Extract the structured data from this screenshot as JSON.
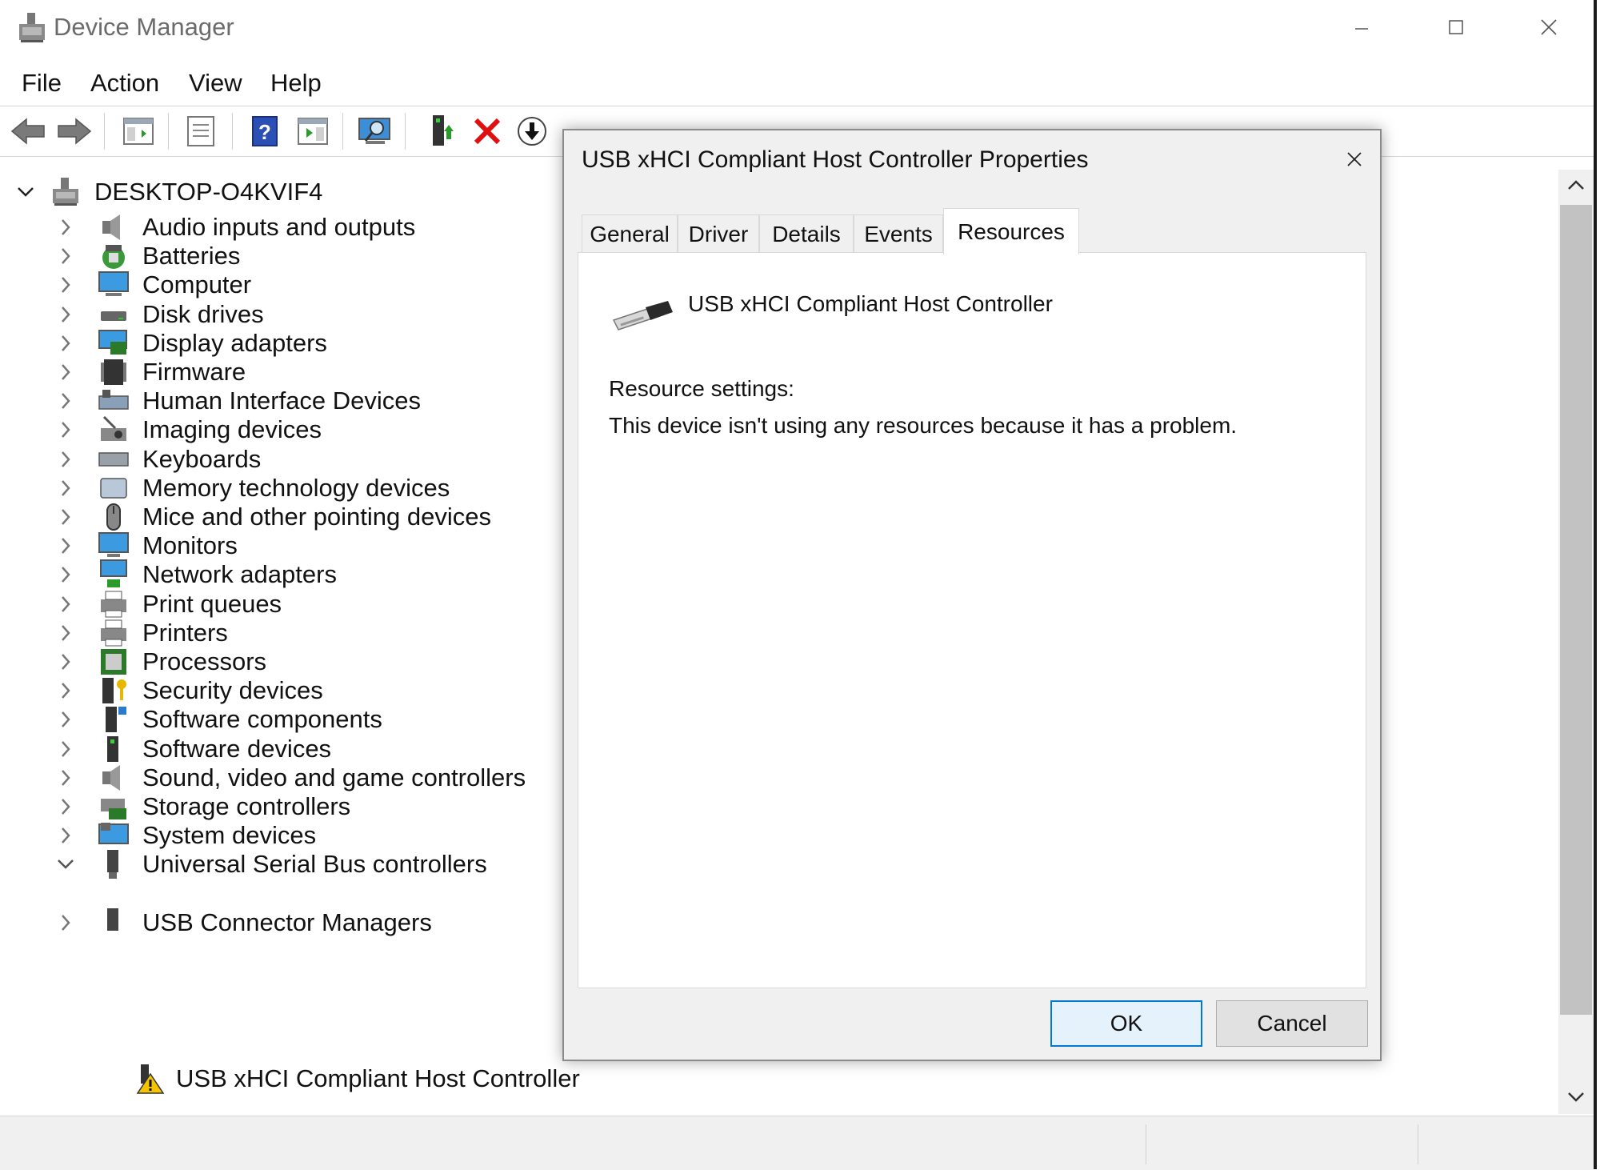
{
  "window": {
    "title": "Device Manager"
  },
  "menu": [
    "File",
    "Action",
    "View",
    "Help"
  ],
  "tree": {
    "root": "DESKTOP-O4KVIF4",
    "categories": [
      "Audio inputs and outputs",
      "Batteries",
      "Computer",
      "Disk drives",
      "Display adapters",
      "Firmware",
      "Human Interface Devices",
      "Imaging devices",
      "Keyboards",
      "Memory technology devices",
      "Mice and other pointing devices",
      "Monitors",
      "Network adapters",
      "Print queues",
      "Printers",
      "Processors",
      "Security devices",
      "Software components",
      "Software devices",
      "Sound, video and game controllers",
      "Storage controllers",
      "System devices",
      "Universal Serial Bus controllers"
    ],
    "expanded_child": "USB xHCI Compliant Host Controller",
    "partial_last": "USB Connector Managers"
  },
  "dialog": {
    "title": "USB xHCI Compliant Host Controller Properties",
    "tabs": [
      "General",
      "Driver",
      "Details",
      "Events",
      "Resources"
    ],
    "active_tab": "Resources",
    "device_name": "USB xHCI Compliant Host Controller",
    "resource_label": "Resource settings:",
    "resource_message": "This device isn't using any resources because it has a problem.",
    "ok_label": "OK",
    "cancel_label": "Cancel"
  }
}
